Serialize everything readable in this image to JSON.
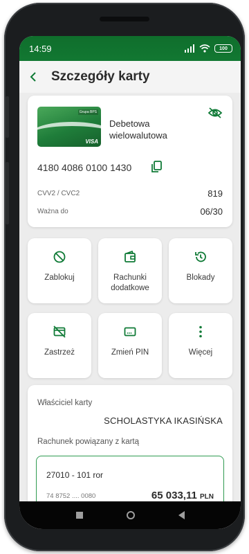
{
  "status_bar": {
    "time": "14:59",
    "battery": "100"
  },
  "header": {
    "title": "Szczegóły karty"
  },
  "card": {
    "name": "Debetowa wielowalutowa",
    "bank_logo": "Grupa BPS",
    "brand": "VISA",
    "number": "4180 4086 0100 1430",
    "cvv_label": "CVV2 / CVC2",
    "cvv_value": "819",
    "valid_label": "Ważna do",
    "valid_value": "06/30"
  },
  "actions": [
    {
      "label": "Zablokuj",
      "icon": "block-icon"
    },
    {
      "label": "Rachunki dodatkowe",
      "icon": "wallet-icon"
    },
    {
      "label": "Blokady",
      "icon": "history-icon"
    },
    {
      "label": "Zastrzeż",
      "icon": "card-off-icon"
    },
    {
      "label": "Zmień PIN",
      "icon": "pin-icon"
    },
    {
      "label": "Więcej",
      "icon": "more-icon"
    }
  ],
  "owner": {
    "label": "Właściciel karty",
    "name": "SCHOLASTYKA IKASIŃSKA",
    "linked_label": "Rachunek powiązany z kartą"
  },
  "account": {
    "name": "27010 - 101 ror",
    "number": "74 8752 .... 0080",
    "balance": "65 033,11",
    "currency": "PLN"
  },
  "colors": {
    "accent": "#0f7a36",
    "status_bar": "#127832"
  }
}
